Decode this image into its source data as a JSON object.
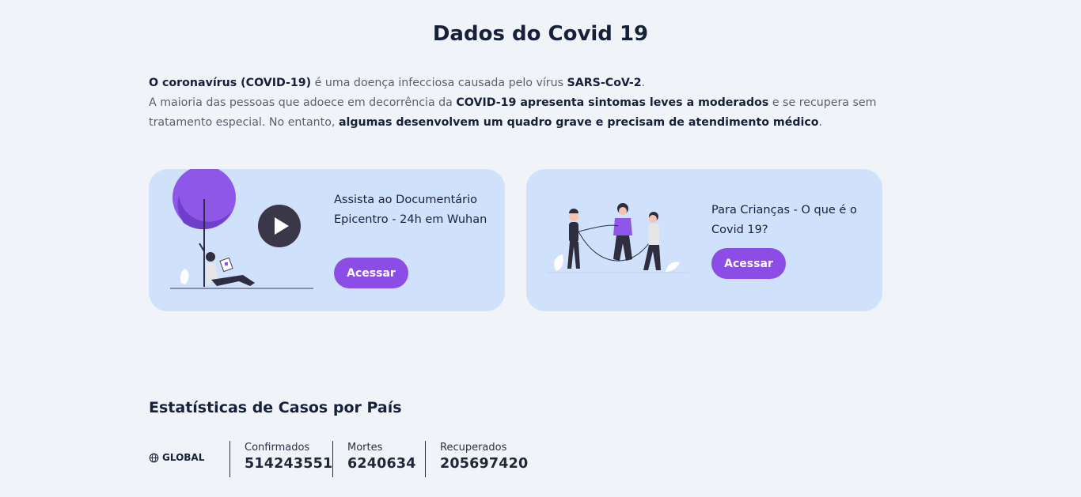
{
  "page": {
    "title": "Dados do Covid 19"
  },
  "intro": {
    "p1_b1": "O coronavírus (COVID-19)",
    "p1_t1": " é uma doença infecciosa causada pelo vírus ",
    "p1_b2": "SARS-CoV-2",
    "p1_t2": ".",
    "p2_t1": "A maioria das pessoas que adoece em decorrência da ",
    "p2_b1": "COVID-19 apresenta sintomas leves a moderados",
    "p2_t2": " e se recupera sem tratamento especial. No entanto, ",
    "p2_b2": "algumas desenvolvem um quadro grave e precisam de atendimento médico",
    "p2_t3": "."
  },
  "cards": [
    {
      "text": "Assista ao Documentário Epicentro - 24h em Wuhan",
      "button": "Acessar"
    },
    {
      "text": "Para Crianças - O que é o Covid 19?",
      "button": "Acessar"
    }
  ],
  "stats": {
    "title": "Estatísticas de Casos por País",
    "scope": "GLOBAL",
    "scope_icon": "globe-icon",
    "items": [
      {
        "label": "Confirmados",
        "value": "514243551"
      },
      {
        "label": "Mortes",
        "value": "6240634"
      },
      {
        "label": "Recuperados",
        "value": "205697420"
      }
    ]
  },
  "colors": {
    "background": "#f0f3f7",
    "card": "#cfe1fb",
    "accent": "#8c4de6",
    "text": "#17203a"
  }
}
